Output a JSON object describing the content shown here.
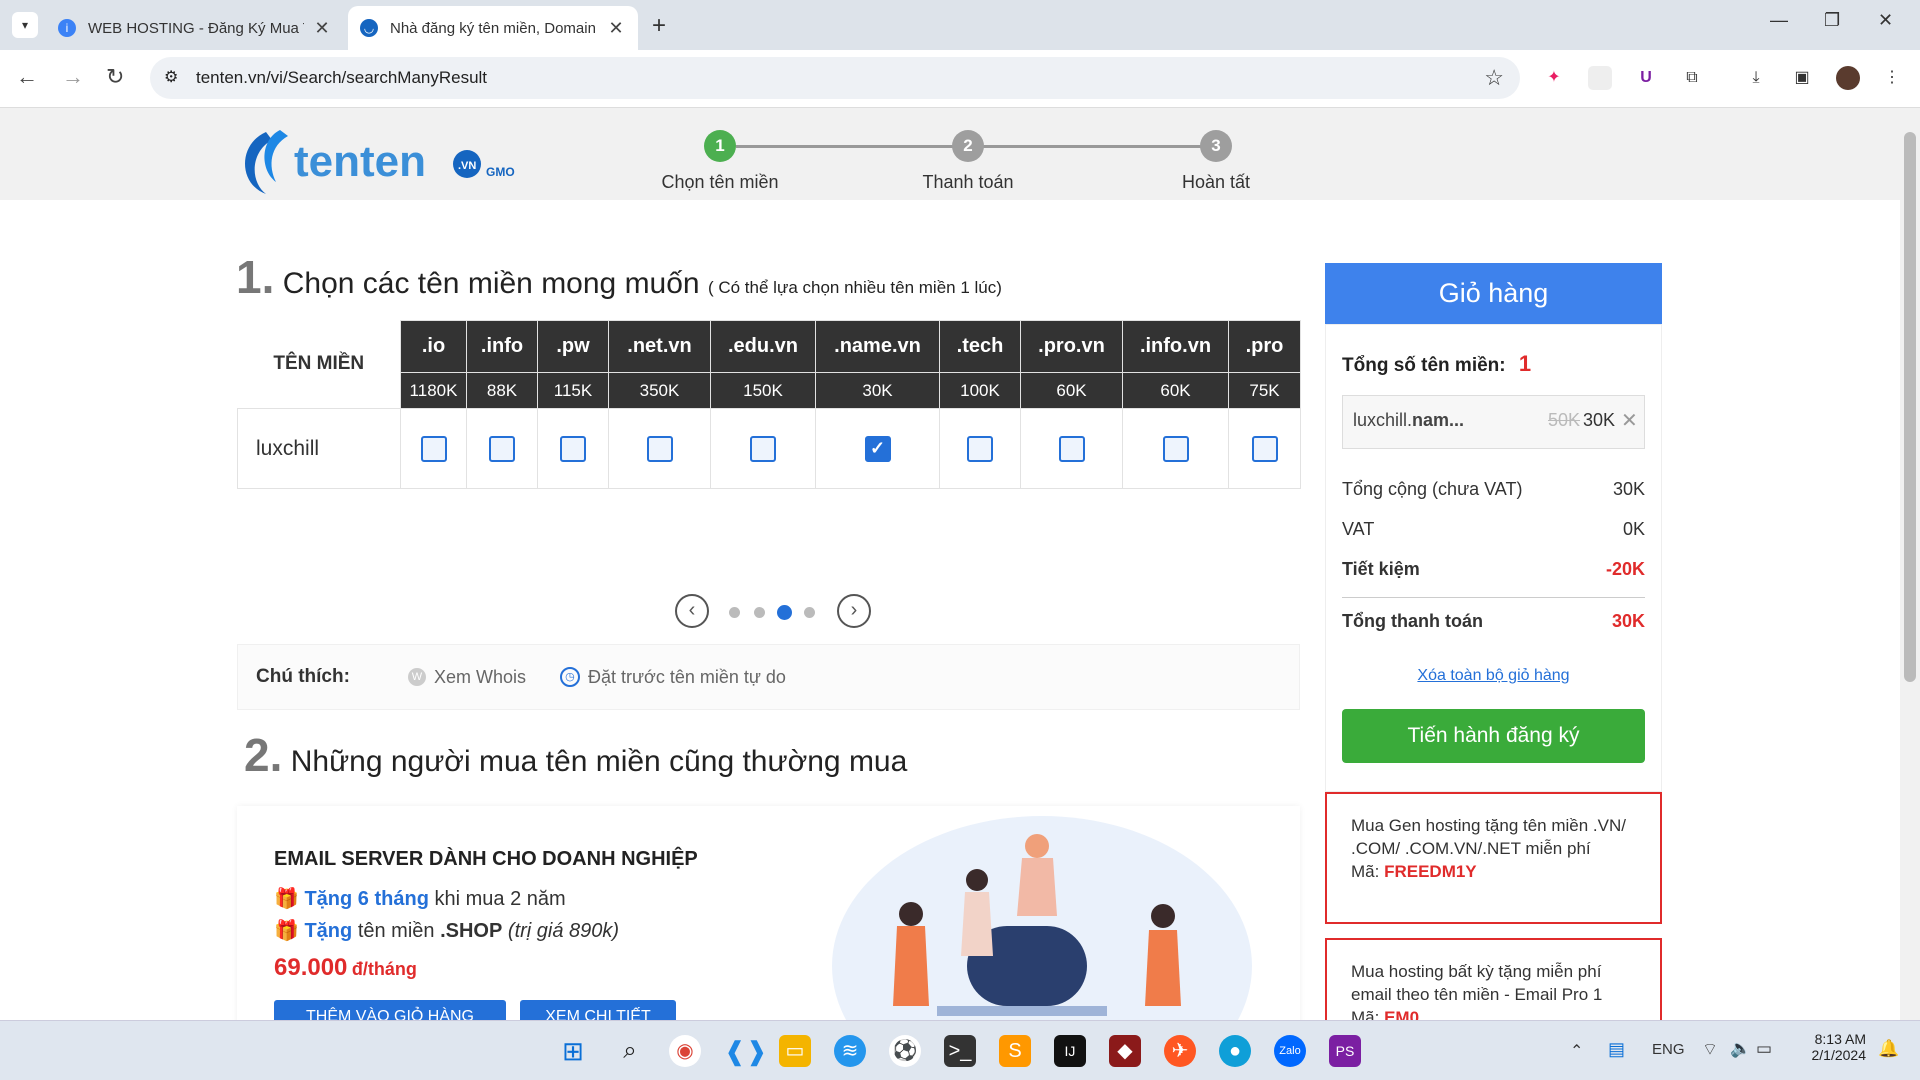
{
  "browser": {
    "tabs": [
      {
        "label": "WEB HOSTING - Đăng Ký Mua T"
      },
      {
        "label": "Nhà đăng ký tên miền, Domain"
      }
    ],
    "url": "tenten.vn/vi/Search/searchManyResult"
  },
  "steps": [
    {
      "num": "1",
      "label": "Chọn tên miền"
    },
    {
      "num": "2",
      "label": "Thanh toán"
    },
    {
      "num": "3",
      "label": "Hoàn tất"
    }
  ],
  "section1": {
    "num": "1.",
    "title": "Chọn các tên miền mong muốn",
    "hint": "( Có thể lựa chọn nhiều tên miền 1 lúc)",
    "col_header": "TÊN MIỀN"
  },
  "domains": {
    "tlds": [
      ".io",
      ".info",
      ".pw",
      ".net.vn",
      ".edu.vn",
      ".name.vn",
      ".tech",
      ".pro.vn",
      ".info.vn",
      ".pro"
    ],
    "prices": [
      "1180K",
      "88K",
      "115K",
      "350K",
      "150K",
      "30K",
      "100K",
      "60K",
      "60K",
      "75K"
    ],
    "name": "luxchill",
    "checked": [
      false,
      false,
      false,
      false,
      false,
      true,
      false,
      false,
      false,
      false
    ]
  },
  "legend": {
    "label": "Chú thích:",
    "whois": "Xem Whois",
    "reserve": "Đặt trước tên miền tự do"
  },
  "section2": {
    "num": "2.",
    "title": "Những người mua tên miền cũng thường mua"
  },
  "promo": {
    "title": "EMAIL SERVER DÀNH CHO DOANH NGHIỆP",
    "line1_a": "Tặng 6 tháng",
    "line1_b": "khi mua 2 năm",
    "line2_a": "Tặng",
    "line2_b": "tên miền",
    "line2_c": ".SHOP",
    "line2_d": "(trị giá 890k)",
    "price": "69.000",
    "unit": "đ/tháng",
    "btn_add": "THÊM VÀO GIỎ HÀNG",
    "btn_detail": "XEM CHI TIẾT"
  },
  "cart": {
    "title": "Giỏ hàng",
    "count_label": "Tổng số tên miền:",
    "count": "1",
    "item_a": "luxchill.",
    "item_b": "nam...",
    "item_old": "50K",
    "item_price": "30K",
    "subtotal_label": "Tổng cộng (chưa VAT)",
    "subtotal": "30K",
    "vat_label": "VAT",
    "vat": "0K",
    "save_label": "Tiết kiệm",
    "save": "-20K",
    "total_label": "Tổng thanh toán",
    "total": "30K",
    "clear": "Xóa toàn bộ giỏ hàng",
    "register": "Tiến hành đăng ký"
  },
  "coupons": [
    {
      "text": "Mua Gen hosting tặng tên miền .VN/ .COM/ .COM.VN/.NET miễn phí",
      "code_label": "Mã:",
      "code": "FREEDM1Y"
    },
    {
      "text": "Mua hosting bất kỳ tặng miễn phí email theo tên miền - Email Pro 1",
      "code_label": "Mã:",
      "code": "EM0"
    }
  ],
  "tray": {
    "lang": "ENG",
    "time": "8:13 AM",
    "date": "2/1/2024"
  },
  "colors": {
    "accent": "#3e82ec",
    "green": "#3aab3a",
    "red": "#e02b2b",
    "step_active": "#4caf50"
  }
}
